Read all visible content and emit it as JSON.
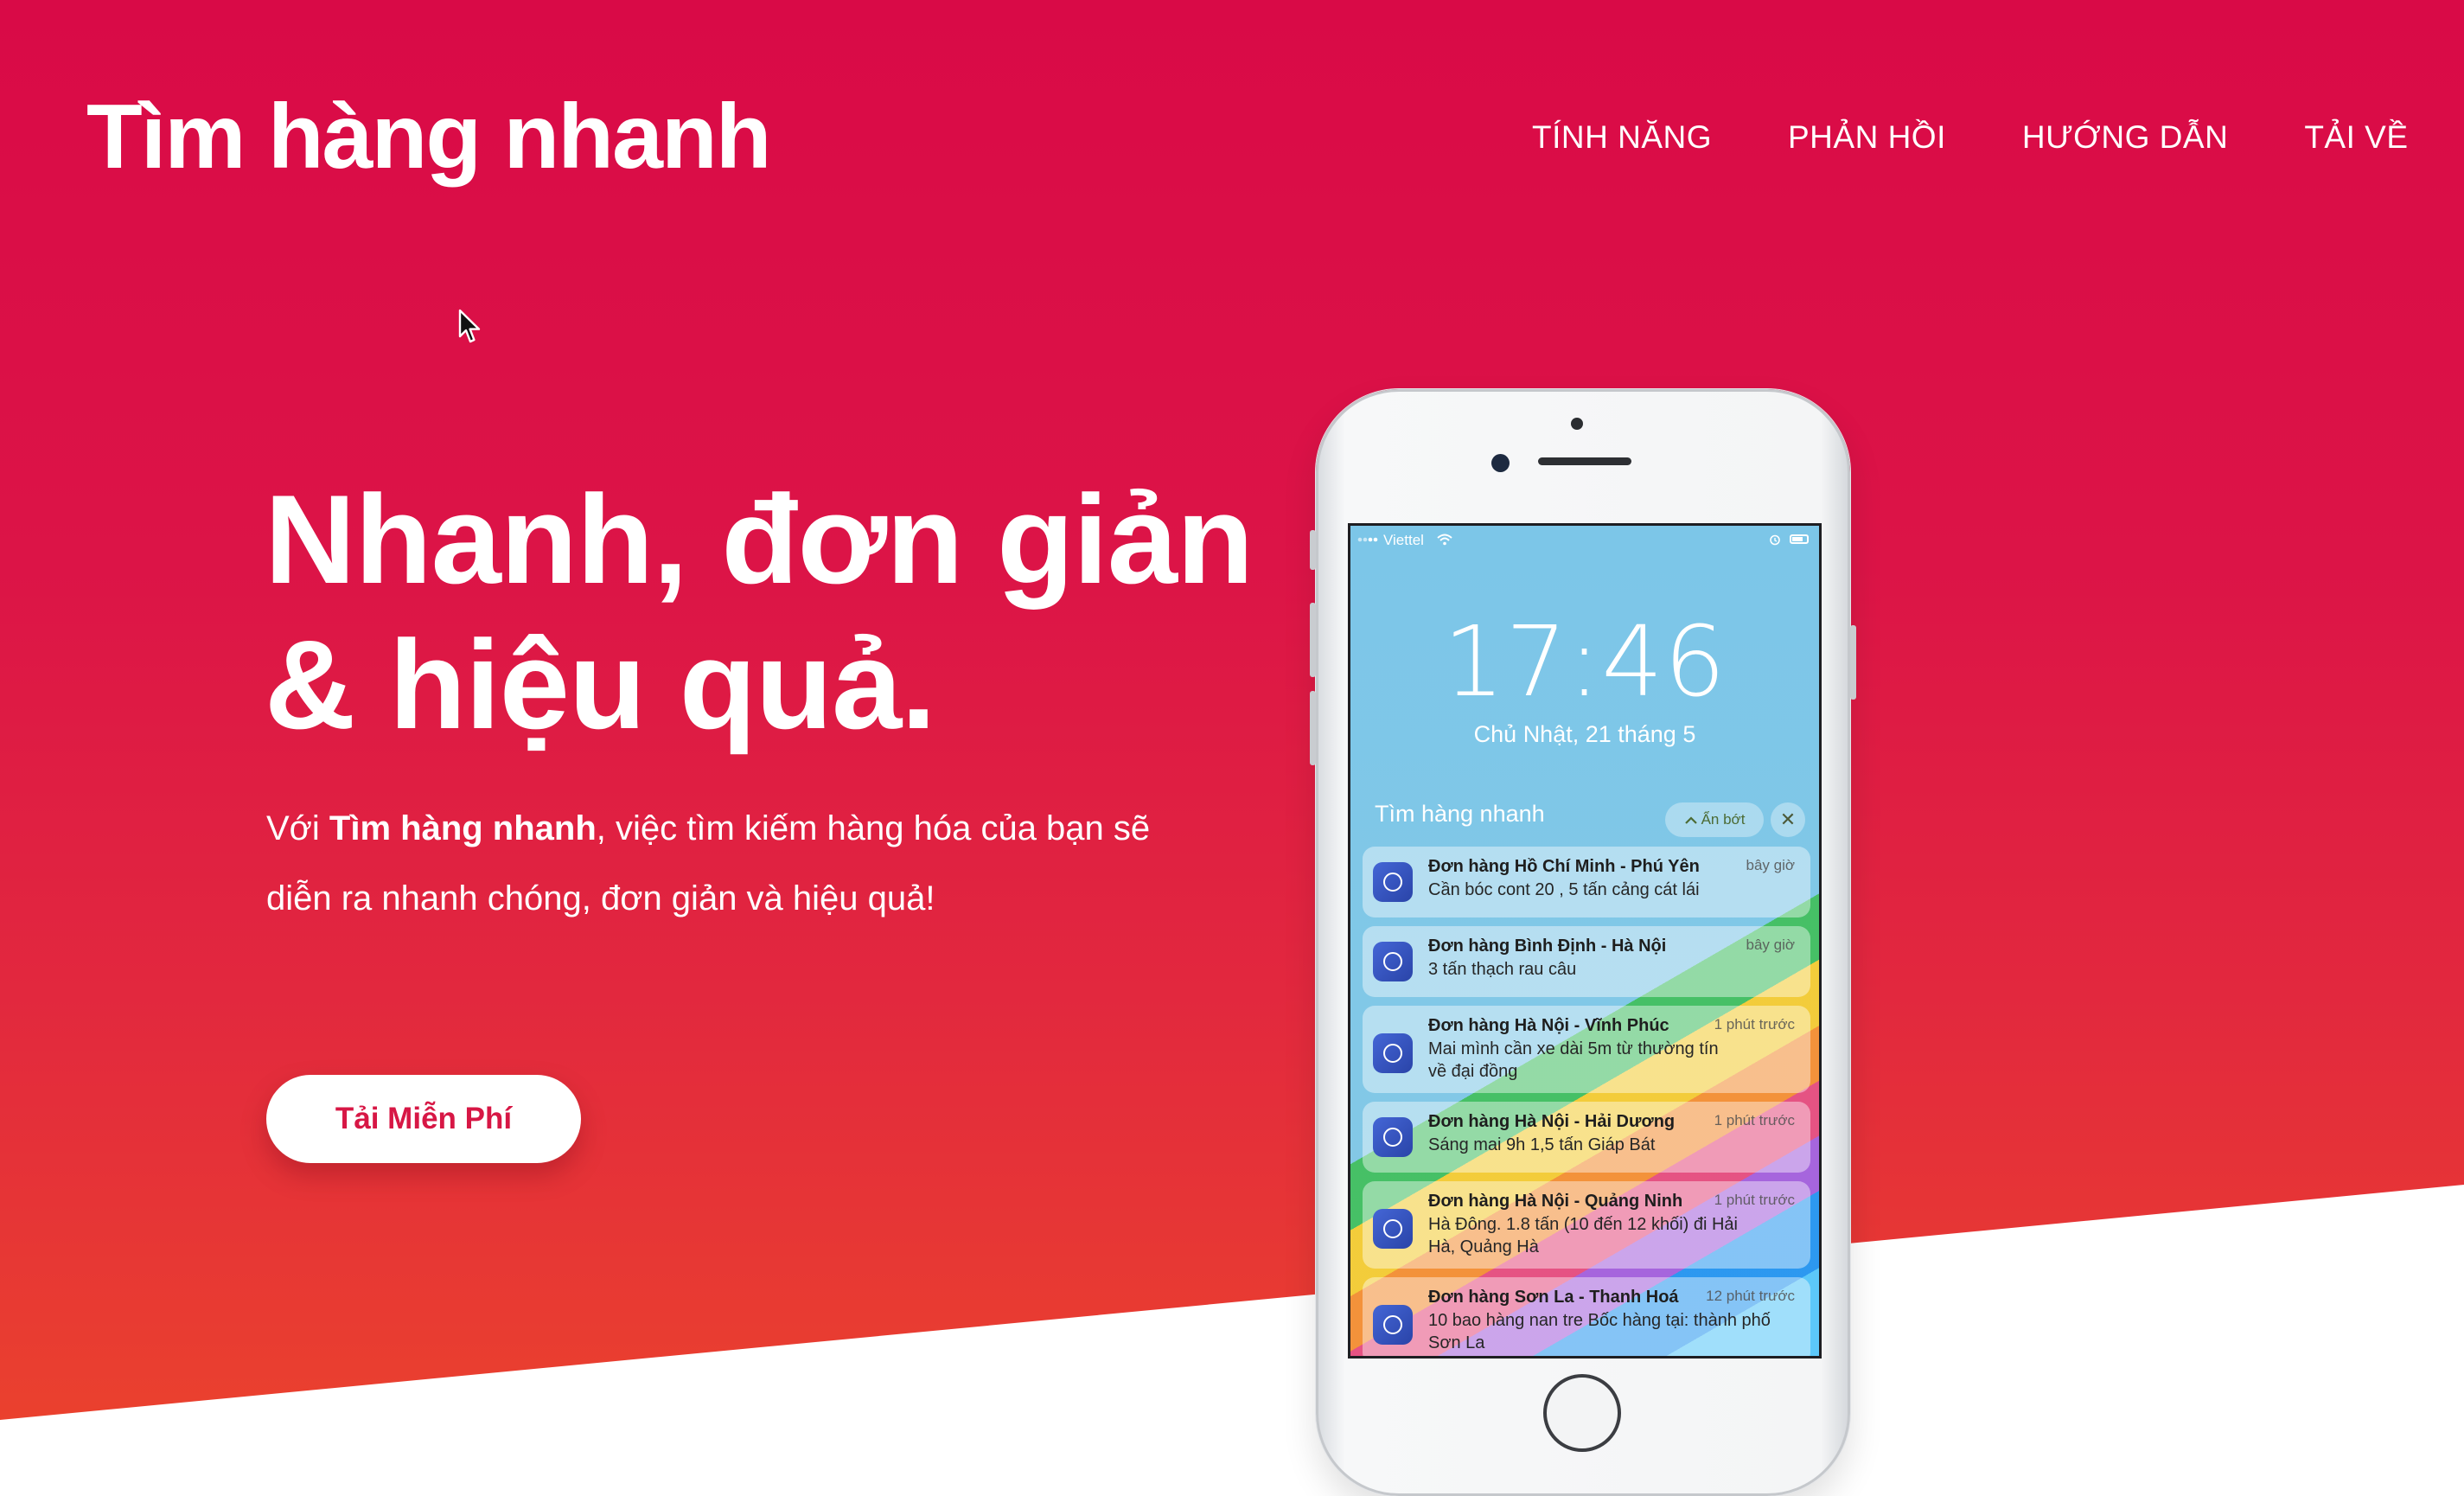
{
  "brand": {
    "name": "Tìm hàng nhanh"
  },
  "nav": {
    "items": [
      "TÍNH NĂNG",
      "PHẢN HỒI",
      "HƯỚNG DẪN",
      "TẢI VỀ"
    ]
  },
  "hero": {
    "headline_line1": "Nhanh, đơn giản",
    "headline_line2": "& hiệu quả.",
    "desc_prefix": "Với ",
    "desc_brand": "Tìm hàng nhanh",
    "desc_suffix": ", việc tìm kiếm hàng hóa của bạn sẽ diễn ra nhanh chóng, đơn giản và hiệu quả!",
    "cta_label": "Tải Miễn Phí"
  },
  "phone": {
    "carrier": "Viettel",
    "time": "17:46",
    "date": "Chủ Nhật, 21 tháng 5",
    "group_label": "Tìm hàng nhanh",
    "show_less_label": "Ẩn bớt",
    "close_label": "✕",
    "notifications": [
      {
        "title": "Đơn hàng Hồ Chí Minh - Phú Yên",
        "time": "bây giờ",
        "body": "Cần bóc cont 20 , 5 tấn cảng cát lái"
      },
      {
        "title": "Đơn hàng Bình Định - Hà Nội",
        "time": "bây giờ",
        "body": "3 tấn thạch rau câu"
      },
      {
        "title": "Đơn hàng Hà Nội - Vĩnh Phúc",
        "time": "1 phút trước",
        "body": "Mai mình cần xe dài 5m từ thường tín về đại đồng"
      },
      {
        "title": "Đơn hàng Hà Nội - Hải Dương",
        "time": "1 phút trước",
        "body": "Sáng mai 9h 1,5 tấn Giáp Bát"
      },
      {
        "title": "Đơn hàng Hà Nội - Quảng Ninh",
        "time": "1 phút trước",
        "body": "Hà Đông. 1.8 tấn (10 đến 12 khối) đi Hải Hà, Quảng Hà"
      },
      {
        "title": "Đơn hàng Sơn La - Thanh Hoá",
        "time": "12 phút trước",
        "body": "10 bao hàng nan tre Bốc hàng tại: thành phố Sơn La"
      }
    ]
  },
  "colors": {
    "hero_top": "#d90a47",
    "hero_bottom": "#ea412e",
    "cta_text": "#d71745"
  },
  "icons": {
    "cursor": "mouse-pointer-icon",
    "app": "box-app-icon",
    "wifi": "wifi-icon",
    "battery": "battery-icon",
    "chevron": "chevron-up-icon"
  }
}
